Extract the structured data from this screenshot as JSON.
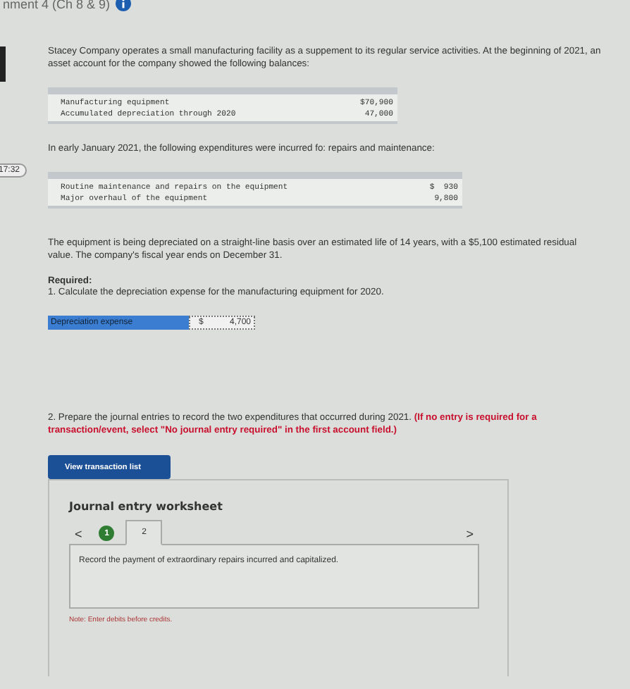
{
  "header": {
    "title": "nment 4 (Ch 8 & 9)"
  },
  "timer": "17:32",
  "intro": "Stacey Company operates a small manufacturing facility as a suppement to its regular service activities. At the beginning of 2021, an asset account for the company showed the following balances:",
  "balances": [
    {
      "label": "Manufacturing equipment",
      "amount": "$70,900"
    },
    {
      "label": "Accumulated depreciation through 2020",
      "amount": "47,000"
    }
  ],
  "expenditures_intro": "In early January 2021, the following expenditures were incurred fo: repairs and maintenance:",
  "expenditures": [
    {
      "label": "Routine maintenance and repairs on the equipment",
      "amount": "$  930"
    },
    {
      "label": "Major overhaul of the equipment",
      "amount": "9,800"
    }
  ],
  "description": "The equipment is being depreciated on a straight-line basis over an estimated life of 14 years, with a $5,100 estimated residual value. The company's fiscal year ends on December 31.",
  "required_heading": "Required:",
  "question_1": "1. Calculate the depreciation expense for the manufacturing equipment for 2020.",
  "answer": {
    "label": "Depreciation expense",
    "currency": "$",
    "value": "4,700"
  },
  "question_2": "2. Prepare the journal entries to record the two expenditures that occurred during 2021.",
  "question_2_note": "(If no entry is required for a transaction/event, select \"No journal entry required\" in the first account field.)",
  "view_button": "View transaction list",
  "worksheet": {
    "title": "Journal entry worksheet",
    "prev": "<",
    "next": ">",
    "tabs": [
      {
        "label": "1",
        "selected": false,
        "done": true
      },
      {
        "label": "2",
        "selected": true,
        "done": false
      }
    ],
    "instruction": "Record the payment of extraordinary repairs incurred and capitalized.",
    "note": "Note: Enter debits before credits."
  }
}
